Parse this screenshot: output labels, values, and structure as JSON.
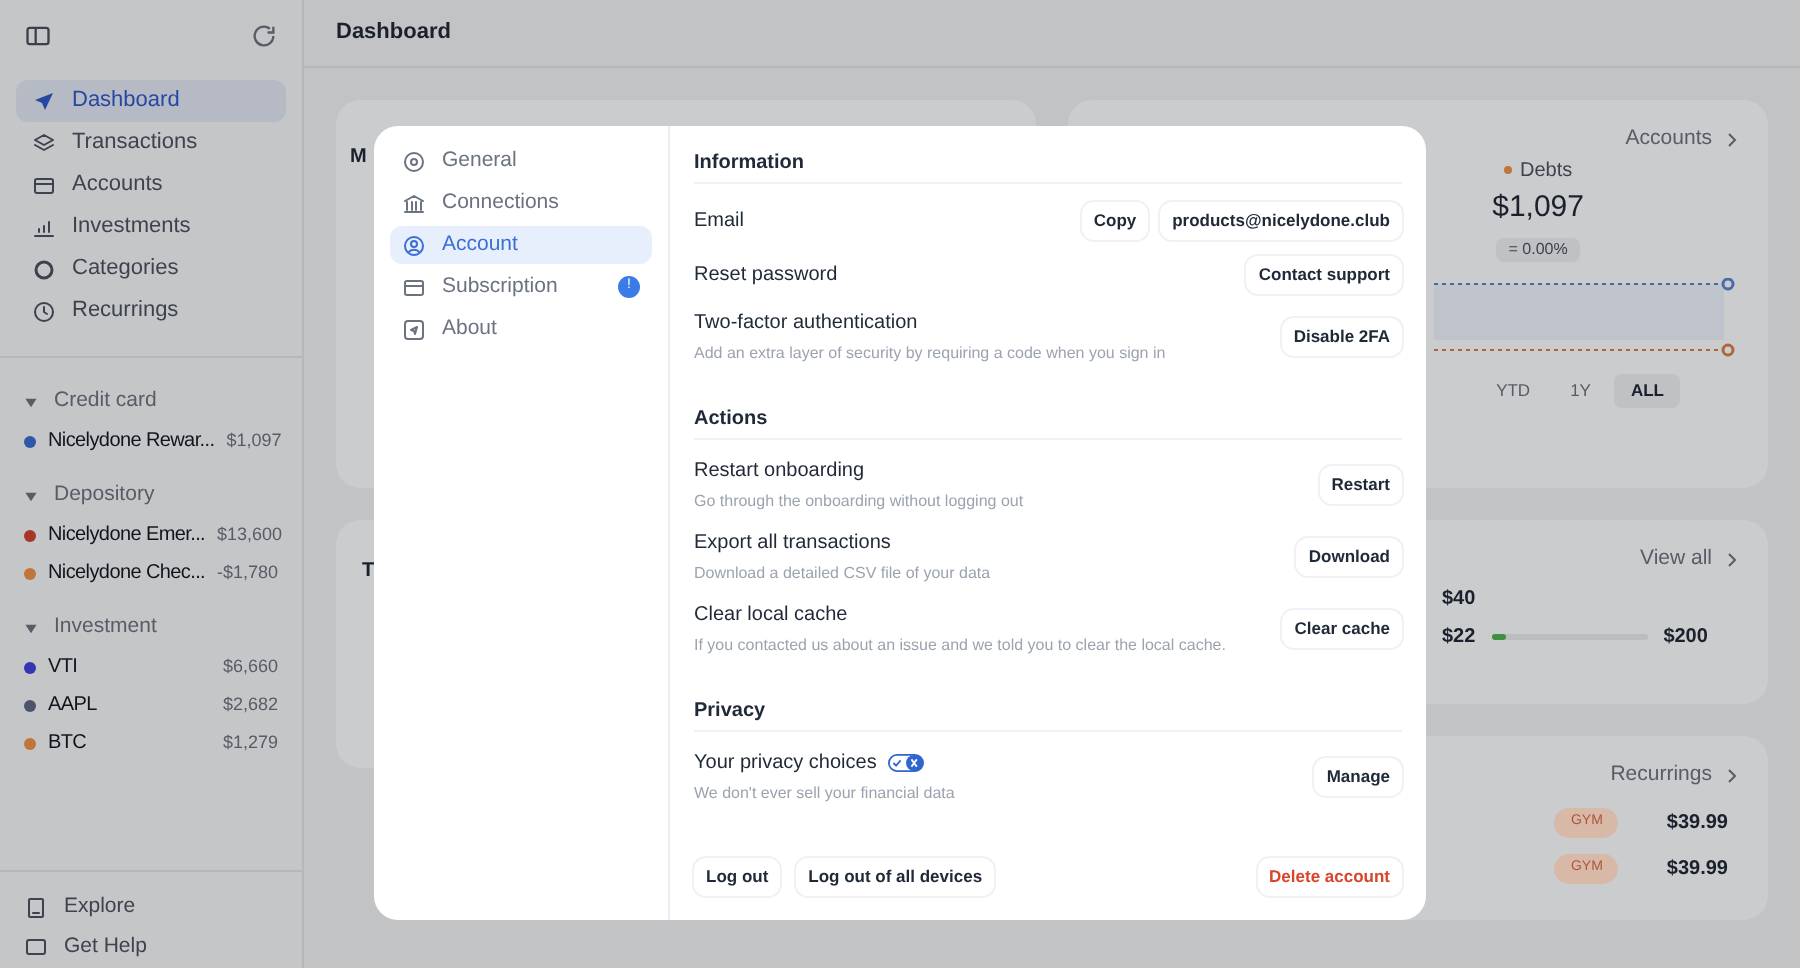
{
  "sidebar": {
    "nav": [
      {
        "label": "Dashboard",
        "selected": true
      },
      {
        "label": "Transactions",
        "selected": false
      },
      {
        "label": "Accounts",
        "selected": false
      },
      {
        "label": "Investments",
        "selected": false
      },
      {
        "label": "Categories",
        "selected": false
      },
      {
        "label": "Recurrings",
        "selected": false
      }
    ],
    "groups": [
      {
        "title": "Credit card",
        "expanded": true,
        "accounts": [
          {
            "name": "Nicelydone Rewar...",
            "amount": "$1,097",
            "color": "#2f56a8"
          }
        ]
      },
      {
        "title": "Depository",
        "expanded": true,
        "accounts": [
          {
            "name": "Nicelydone Emer...",
            "amount": "$13,600",
            "color": "#a8352a"
          },
          {
            "name": "Nicelydone Chec...",
            "amount": "-$1,780",
            "color": "#c0753a"
          }
        ]
      },
      {
        "title": "Investment",
        "expanded": true,
        "accounts": [
          {
            "name": "VTI",
            "amount": "$6,660",
            "color": "#3535b0"
          },
          {
            "name": "AAPL",
            "amount": "$2,682",
            "color": "#4d5468"
          },
          {
            "name": "BTC",
            "amount": "$1,279",
            "color": "#c0753a"
          }
        ]
      }
    ],
    "footer": [
      {
        "label": "Explore"
      },
      {
        "label": "Get Help"
      }
    ]
  },
  "header": {
    "title": "Dashboard"
  },
  "cards": {
    "top_left_letter": "M",
    "accounts_link": "Accounts",
    "debts_label": "Debts",
    "debts_value": "$1,097",
    "debts_change": "= 0.00%",
    "ranges": [
      {
        "label": "YTD",
        "selected": false
      },
      {
        "label": "1Y",
        "selected": false
      },
      {
        "label": "ALL",
        "selected": true
      }
    ],
    "second_left_letter": "T",
    "view_all": "View all",
    "budget": {
      "spent": "$40",
      "current": "$22",
      "total": "$200",
      "level": 0.1
    },
    "recurrings_link": "Recurrings",
    "recurrings": [
      {
        "tag": "GYM",
        "amount": "$39.99"
      },
      {
        "tag": "GYM",
        "amount": "$39.99"
      }
    ]
  },
  "modal": {
    "nav": [
      {
        "label": "General",
        "selected": false,
        "alert": false
      },
      {
        "label": "Connections",
        "selected": false,
        "alert": false
      },
      {
        "label": "Account",
        "selected": true,
        "alert": false
      },
      {
        "label": "Subscription",
        "selected": false,
        "alert": true
      },
      {
        "label": "About",
        "selected": false,
        "alert": false
      }
    ],
    "alert_badge": "!",
    "sections": [
      {
        "title": "Information",
        "rows": [
          {
            "label": "Email",
            "buttons": [
              "Copy",
              "products@nicelydone.club"
            ]
          },
          {
            "label": "Reset password",
            "buttons": [
              "Contact support"
            ]
          },
          {
            "label": "Two-factor authentication",
            "description": "Add an extra layer of security by requiring a code when you sign in",
            "buttons": [
              "Disable 2FA"
            ]
          }
        ]
      },
      {
        "title": "Actions",
        "rows": [
          {
            "label": "Restart onboarding",
            "description": "Go through the onboarding without logging out",
            "buttons": [
              "Restart"
            ]
          },
          {
            "label": "Export all transactions",
            "description": "Download a detailed CSV file of your data",
            "buttons": [
              "Download"
            ]
          },
          {
            "label": "Clear local cache",
            "description": "If you contacted us about an issue and we told you to clear the local cache.",
            "buttons": [
              "Clear cache"
            ]
          }
        ]
      },
      {
        "title": "Privacy",
        "rows": [
          {
            "label": "Your privacy choices",
            "privacy_toggle": true,
            "description": "We don't ever sell your financial data",
            "buttons": [
              "Manage"
            ]
          }
        ]
      }
    ],
    "footer_buttons": [
      {
        "label": "Log out",
        "kind": "normal"
      },
      {
        "label": "Log out of all devices",
        "kind": "normal"
      },
      {
        "label": "Delete account",
        "kind": "danger"
      }
    ]
  }
}
